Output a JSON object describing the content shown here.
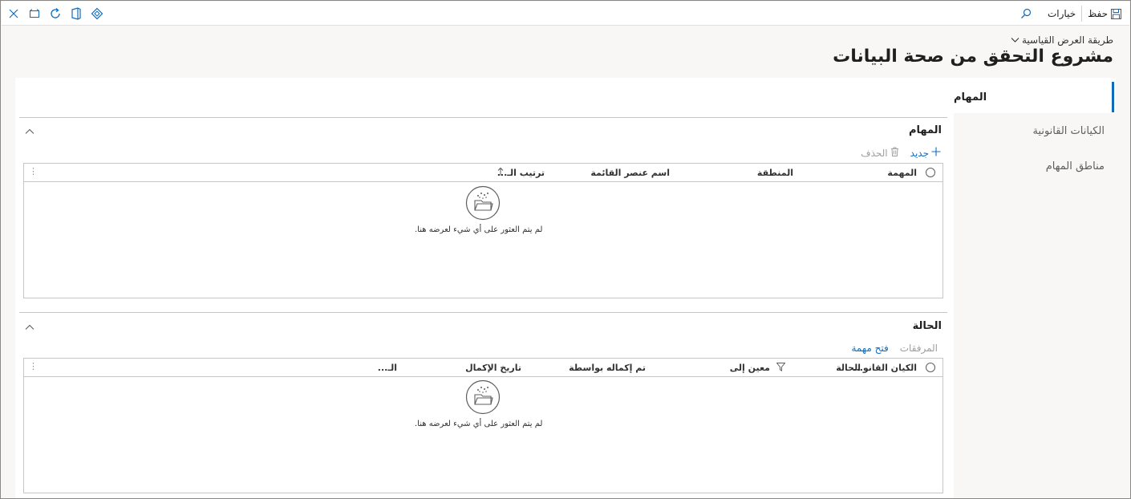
{
  "commandbar": {
    "save_label": "حفظ",
    "options_label": "خيارات",
    "icons": [
      "close-icon",
      "new-window-icon",
      "refresh-icon",
      "office-icon",
      "power-apps-icon",
      "search-icon",
      "save-icon"
    ]
  },
  "header": {
    "view_label": "طريقة العرض القياسية",
    "title": "مشروع التحقق من صحة البيانات"
  },
  "nav": {
    "items": [
      {
        "label": "المهام"
      },
      {
        "label": "الكيانات القانونية"
      },
      {
        "label": "مناطق المهام"
      }
    ]
  },
  "tasks_section": {
    "title": "المهام",
    "new_label": "جديد",
    "delete_label": "الحذف",
    "columns": [
      "المهمة",
      "المنطقة",
      "اسم عنصر القائمة",
      "ترتيب الـ..."
    ],
    "empty_text": "لم يتم العثور على أي شيء لعرضه هنا."
  },
  "status_section": {
    "title": "الحالة",
    "attachments_label": "المرفقات",
    "open_task_label": "فتح مهمة",
    "columns": [
      "الكيان القانو...",
      "الحالة",
      "معين إلى",
      "تم إكماله بواسطة",
      "تاريخ الإكمال",
      "الـ..."
    ],
    "empty_text": "لم يتم العثور على أي شيء لعرضه هنا."
  },
  "colors": {
    "accent": "#0f6cbd",
    "background": "#f8f7f6",
    "border": "#c8c6c4"
  }
}
